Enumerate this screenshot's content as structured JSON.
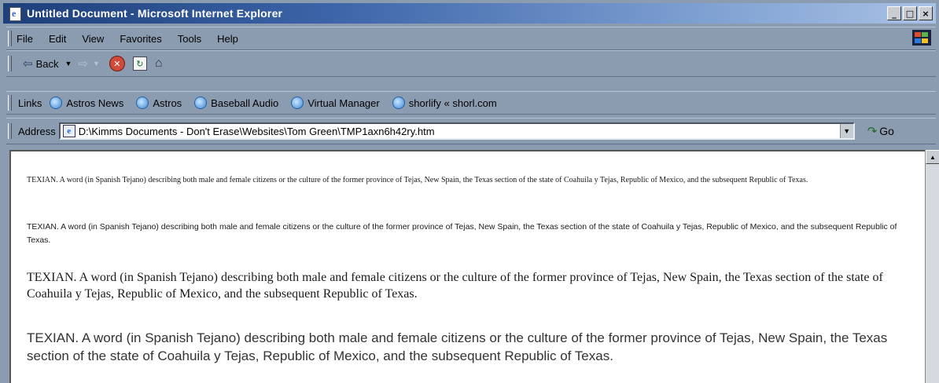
{
  "window": {
    "title": "Untitled Document - Microsoft Internet Explorer",
    "buttons": {
      "minimize": "_",
      "maximize": "□",
      "close": "×"
    }
  },
  "menu": [
    "File",
    "Edit",
    "View",
    "Favorites",
    "Tools",
    "Help"
  ],
  "toolbar": {
    "back_label": "Back"
  },
  "links": {
    "label": "Links",
    "items": [
      "Astros News",
      "Astros",
      "Baseball Audio",
      "Virtual Manager",
      "shorlify « shorl.com"
    ]
  },
  "address": {
    "label": "Address",
    "value": "D:\\Kimms Documents - Don't Erase\\Websites\\Tom Green\\TMP1axn6h42ry.htm",
    "go_label": "Go"
  },
  "content": {
    "paragraphs": [
      "TEXIAN. A word (in Spanish Tejano) describing both male and female citizens or the culture of the former province of Tejas, New Spain, the Texas section of the state of Coahuila y Tejas, Republic of Mexico, and the subsequent Republic of Texas.",
      "TEXIAN. A word (in Spanish Tejano) describing both male and female citizens or the culture of the former province of Tejas, New Spain, the Texas section of the state of Coahuila y Tejas, Republic of Mexico, and the subsequent Republic of Texas.",
      "TEXIAN. A word (in Spanish Tejano) describing both male and female citizens or the culture of the former province of Tejas, New Spain, the Texas section of the state of Coahuila y Tejas, Republic of Mexico, and the subsequent Republic of Texas.",
      "TEXIAN. A word (in Spanish Tejano) describing both male and female citizens or the culture of the former province of Tejas, New Spain, the Texas section of the state of Coahuila y Tejas, Republic of Mexico, and the subsequent Republic of Texas."
    ]
  },
  "colors": {
    "chrome": "#8c9cb0",
    "titlebar_start": "#1d3f7a",
    "titlebar_end": "#a9c1e4"
  }
}
